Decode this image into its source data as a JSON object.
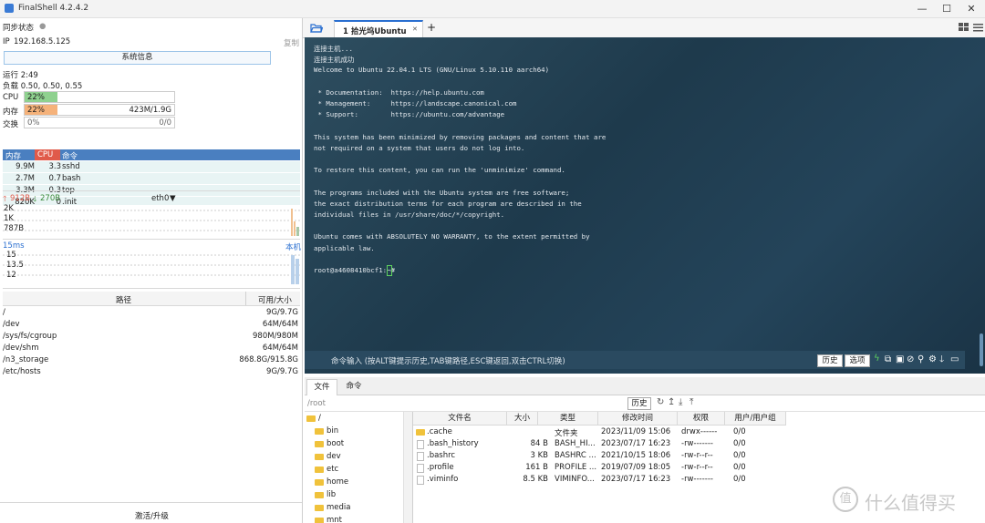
{
  "app": {
    "title": "FinalShell 4.2.4.2"
  },
  "window": {
    "minimize": "—",
    "maximize": "☐",
    "close": "✕"
  },
  "sync": {
    "label": "同步状态",
    "dot": "●"
  },
  "ip": {
    "label": "IP",
    "value": "192.168.5.125",
    "copy": "复制"
  },
  "sysinfo_button": "系统信息",
  "uptime": "运行 2:49",
  "load": "负载 0.50, 0.50, 0.55",
  "cpu": {
    "label": "CPU",
    "percent": "22%",
    "fraction": 0.22
  },
  "mem": {
    "label": "内存",
    "percent": "22%",
    "fraction": 0.22,
    "usage": "423M/1.9G"
  },
  "swap": {
    "label": "交换",
    "percent": "0%",
    "fraction": 0,
    "usage": "0/0"
  },
  "process_table": {
    "headers": [
      "内存",
      "CPU",
      "命令"
    ],
    "rows": [
      {
        "mem": "9.9M",
        "cpu": "3.3",
        "cmd": "sshd"
      },
      {
        "mem": "2.7M",
        "cpu": "0.7",
        "cmd": "bash"
      },
      {
        "mem": "3.3M",
        "cpu": "0.3",
        "cmd": "top"
      },
      {
        "mem": "820K",
        "cpu": "0",
        "cmd": ".init"
      }
    ]
  },
  "network": {
    "up": "912B",
    "down": "270B",
    "iface": "eth0",
    "ticks": [
      "2K",
      "1K",
      "787B"
    ]
  },
  "latency": {
    "value": "15ms",
    "target": "本机",
    "ticks": [
      "15",
      "13.5",
      "12"
    ]
  },
  "disk_table": {
    "headers": [
      "路径",
      "可用/大小"
    ],
    "rows": [
      {
        "path": "/",
        "size": "9G/9.7G"
      },
      {
        "path": "/dev",
        "size": "64M/64M"
      },
      {
        "path": "/sys/fs/cgroup",
        "size": "980M/980M"
      },
      {
        "path": "/dev/shm",
        "size": "64M/64M"
      },
      {
        "path": "/n3_storage",
        "size": "868.8G/915.8G"
      },
      {
        "path": "/etc/hosts",
        "size": "9G/9.7G"
      }
    ]
  },
  "activate": "激活/升级",
  "tabs": [
    {
      "label": "1 拾光坞Ubuntu",
      "close": "✕"
    }
  ],
  "add_tab": "+",
  "terminal": {
    "lines": [
      "连接主机...",
      "连接主机成功",
      "Welcome to Ubuntu 22.04.1 LTS (GNU/Linux 5.10.110 aarch64)",
      "",
      " * Documentation:  https://help.ubuntu.com",
      " * Management:     https://landscape.canonical.com",
      " * Support:        https://ubuntu.com/advantage",
      "",
      "This system has been minimized by removing packages and content that are",
      "not required on a system that users do not log into.",
      "",
      "To restore this content, you can run the 'unminimize' command.",
      "",
      "The programs included with the Ubuntu system are free software;",
      "the exact distribution terms for each program are described in the",
      "individual files in /usr/share/doc/*/copyright.",
      "",
      "Ubuntu comes with ABSOLUTELY NO WARRANTY, to the extent permitted by",
      "applicable law.",
      "",
      "root@a4608410bcf1:~#"
    ]
  },
  "cmdbar": {
    "placeholder": "命令输入 (按ALT键提示历史,TAB键路径,ESC键返回,双击CTRL切换)",
    "history": "历史",
    "options": "选项"
  },
  "file_tabs": [
    "文件",
    "命令"
  ],
  "file_path": "/root",
  "file_history": "历史",
  "tree": [
    {
      "name": "/",
      "level": 0
    },
    {
      "name": "bin",
      "level": 1
    },
    {
      "name": "boot",
      "level": 1
    },
    {
      "name": "dev",
      "level": 1
    },
    {
      "name": "etc",
      "level": 1
    },
    {
      "name": "home",
      "level": 1
    },
    {
      "name": "lib",
      "level": 1
    },
    {
      "name": "media",
      "level": 1
    },
    {
      "name": "mnt",
      "level": 1
    }
  ],
  "file_table": {
    "headers": [
      "文件名",
      "大小",
      "类型",
      "修改时间",
      "权限",
      "用户/用户组"
    ],
    "rows": [
      {
        "name": ".cache",
        "size": "",
        "type": "文件夹",
        "mtime": "2023/11/09 15:06",
        "perm": "drwx------",
        "owner": "0/0",
        "folder": true
      },
      {
        "name": ".bash_history",
        "size": "84 B",
        "type": "BASH_HI...",
        "mtime": "2023/07/17 16:23",
        "perm": "-rw-------",
        "owner": "0/0",
        "folder": false
      },
      {
        "name": ".bashrc",
        "size": "3 KB",
        "type": "BASHRC ...",
        "mtime": "2021/10/15 18:06",
        "perm": "-rw-r--r--",
        "owner": "0/0",
        "folder": false
      },
      {
        "name": ".profile",
        "size": "161 B",
        "type": "PROFILE ...",
        "mtime": "2019/07/09 18:05",
        "perm": "-rw-r--r--",
        "owner": "0/0",
        "folder": false
      },
      {
        "name": ".viminfo",
        "size": "8.5 KB",
        "type": "VIMINFO...",
        "mtime": "2023/07/17 16:23",
        "perm": "-rw-------",
        "owner": "0/0",
        "folder": false
      }
    ]
  },
  "watermark": {
    "text": "什么值得买",
    "logo": "值"
  },
  "colors": {
    "cpu_fill": "#8fd18f",
    "mem_fill": "#f5b27a",
    "proc_header": "#4a7fc0",
    "proc_cpu_header": "#e05a4a",
    "link": "#2a6fd0",
    "terminal_bg": "#24445a",
    "folder": "#f0c23b"
  }
}
